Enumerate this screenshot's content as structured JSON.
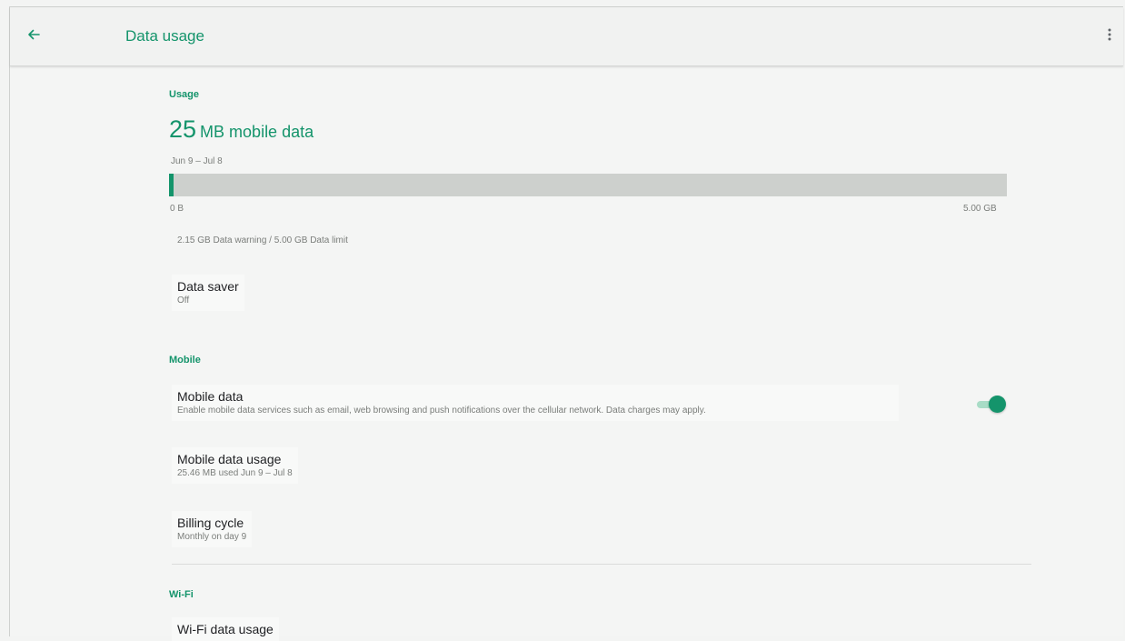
{
  "colors": {
    "accent": "#14946b",
    "bar_track": "#cdd0cd",
    "background": "#f4f5f4"
  },
  "appbar": {
    "back_icon": "arrow-back-icon",
    "title": "Data usage",
    "overflow_icon": "more-vert-icon"
  },
  "usage": {
    "header": "Usage",
    "amount": "25",
    "unit": "MB mobile data",
    "date_range": "Jun 9 – Jul 8",
    "bar_fraction": 0.005,
    "bar_min_label": "0 B",
    "bar_max_label": "5.00 GB",
    "warning_limit": "2.15 GB Data warning / 5.00 GB Data limit"
  },
  "data_saver": {
    "title": "Data saver",
    "summary": "Off"
  },
  "mobile": {
    "header": "Mobile",
    "mobile_data": {
      "title": "Mobile data",
      "summary": "Enable mobile data services such as email, web browsing and push notifications over the cellular network. Data charges may apply.",
      "enabled": true
    },
    "mobile_data_usage": {
      "title": "Mobile data usage",
      "summary": "25.46 MB used Jun 9 – Jul 8"
    },
    "billing_cycle": {
      "title": "Billing cycle",
      "summary": "Monthly on day 9"
    }
  },
  "wifi": {
    "header": "Wi-Fi",
    "wifi_data_usage": {
      "title": "Wi-Fi data usage"
    }
  }
}
